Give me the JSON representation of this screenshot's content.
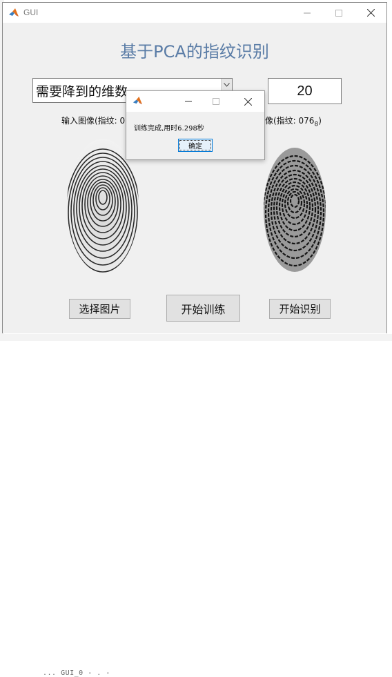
{
  "window": {
    "title": "GUI"
  },
  "app": {
    "heading": "基于PCA的指纹识别",
    "dimension_dropdown": {
      "selected": "需要降到的维数"
    },
    "dimension_value": "20",
    "input_caption": "输入图像(指纹: 0",
    "result_caption_prefix": "图图像(指纹: 076",
    "result_caption_sub": "8",
    "result_caption_suffix": ")",
    "buttons": {
      "select_image": "选择图片",
      "start_training": "开始训练",
      "start_recognition": "开始识别"
    }
  },
  "dialog": {
    "message": "训练完成,用时6.298秒",
    "ok_label": "确定"
  },
  "background": {
    "bottom_text": "...  GUI_0   -   .        -"
  },
  "icons": {
    "app_icon": "matlab-icon",
    "minimize": "minimize-icon",
    "maximize": "maximize-icon",
    "close": "close-icon",
    "dropdown": "chevron-down-icon"
  },
  "colors": {
    "heading": "#5a7ca6",
    "dialog_button_border": "#0078d7"
  }
}
